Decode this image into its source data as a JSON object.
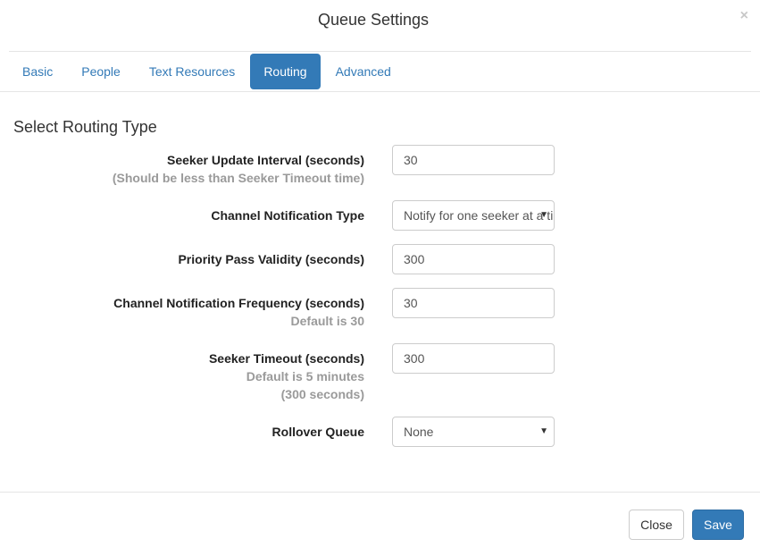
{
  "dialog": {
    "title": "Queue Settings",
    "close_glyph": "×"
  },
  "tabs": [
    {
      "label": "Basic",
      "active": false
    },
    {
      "label": "People",
      "active": false
    },
    {
      "label": "Text Resources",
      "active": false
    },
    {
      "label": "Routing",
      "active": true
    },
    {
      "label": "Advanced",
      "active": false
    }
  ],
  "section": {
    "title": "Select Routing Type"
  },
  "fields": {
    "seeker_update_interval": {
      "label": "Seeker Update Interval (seconds)",
      "help": "(Should be less than Seeker Timeout time)",
      "value": "30"
    },
    "channel_notification_type": {
      "label": "Channel Notification Type",
      "value": "Notify for one seeker at a time"
    },
    "priority_pass_validity": {
      "label": "Priority Pass Validity (seconds)",
      "value": "300"
    },
    "channel_notification_frequency": {
      "label": "Channel Notification Frequency (seconds)",
      "help": "Default is 30",
      "value": "30"
    },
    "seeker_timeout": {
      "label": "Seeker Timeout (seconds)",
      "help_line1": "Default is 5 minutes",
      "help_line2": "(300 seconds)",
      "value": "300"
    },
    "rollover_queue": {
      "label": "Rollover Queue",
      "value": "None"
    }
  },
  "footer": {
    "close_label": "Close",
    "save_label": "Save"
  },
  "colors": {
    "accent": "#337ab7",
    "help_text": "#9a9a9a",
    "border": "#cccccc"
  },
  "icons": {
    "close": "close-icon",
    "dropdown": "chevron-down-icon"
  }
}
